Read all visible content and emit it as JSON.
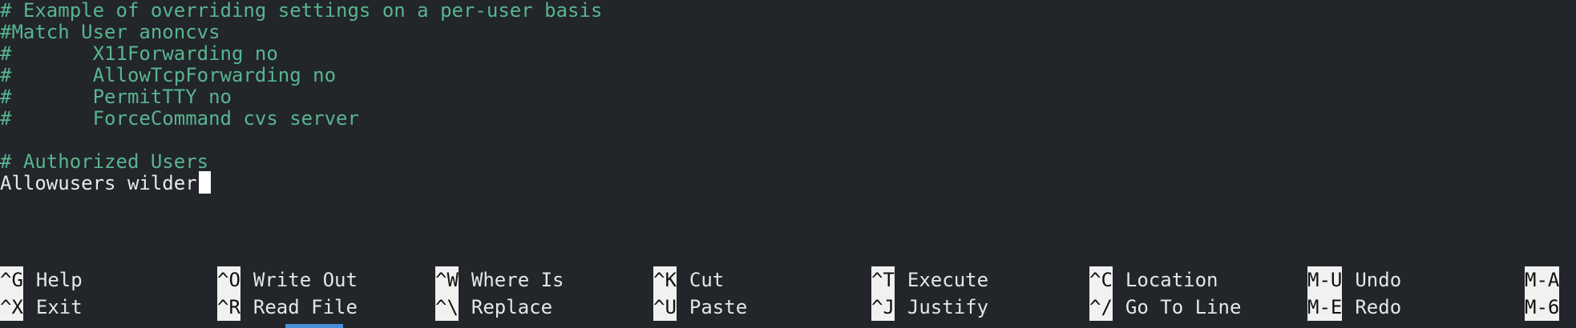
{
  "editor": {
    "lines": [
      {
        "text": "# Example of overriding settings on a per-user basis",
        "style": "comment"
      },
      {
        "text": "#Match User anoncvs",
        "style": "comment"
      },
      {
        "text": "#       X11Forwarding no",
        "style": "comment"
      },
      {
        "text": "#       AllowTcpForwarding no",
        "style": "comment"
      },
      {
        "text": "#       PermitTTY no",
        "style": "comment"
      },
      {
        "text": "#       ForceCommand cvs server",
        "style": "comment"
      },
      {
        "text": "",
        "style": "normal"
      },
      {
        "text": "# Authorized Users",
        "style": "comment"
      },
      {
        "text": "Allowusers wilder",
        "style": "normal"
      }
    ]
  },
  "shortcuts": {
    "row1": [
      {
        "key": "^G",
        "label": "Help"
      },
      {
        "key": "^O",
        "label": "Write Out"
      },
      {
        "key": "^W",
        "label": "Where Is"
      },
      {
        "key": "^K",
        "label": "Cut"
      },
      {
        "key": "^T",
        "label": "Execute"
      },
      {
        "key": "^C",
        "label": "Location"
      },
      {
        "key": "M-U",
        "label": "Undo"
      },
      {
        "key": "M-A",
        "label": ""
      }
    ],
    "row2": [
      {
        "key": "^X",
        "label": "Exit"
      },
      {
        "key": "^R",
        "label": "Read File"
      },
      {
        "key": "^\\",
        "label": "Replace"
      },
      {
        "key": "^U",
        "label": "Paste"
      },
      {
        "key": "^J",
        "label": "Justify"
      },
      {
        "key": "^/",
        "label": "Go To Line"
      },
      {
        "key": "M-E",
        "label": "Redo"
      },
      {
        "key": "M-6",
        "label": ""
      }
    ]
  },
  "colors": {
    "background": "#22252a",
    "comment": "#58b58f",
    "text": "#e8e8e8",
    "key_bg": "#f1f1f1",
    "indicator": "#4a90d9"
  }
}
